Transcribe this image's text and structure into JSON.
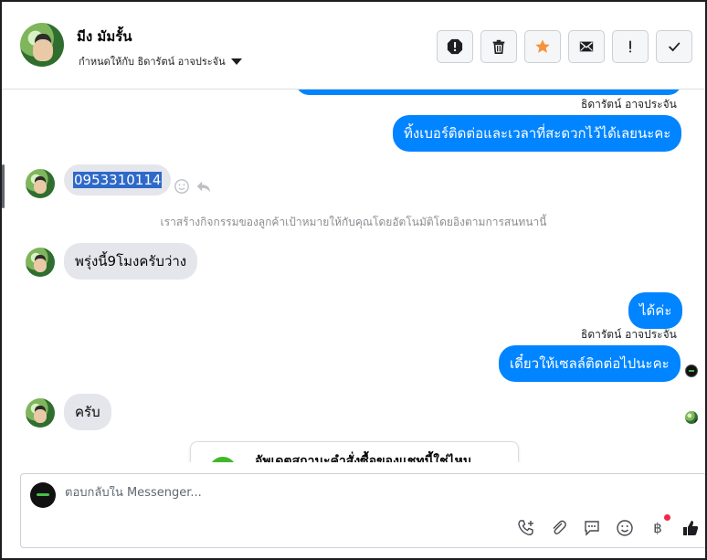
{
  "header": {
    "contact_name": "มีง มัมรั้น",
    "assigned_to": "กำหนดให้กับ ธิดารัตน์ อาจประจัน",
    "actions": [
      "spam-icon",
      "delete-icon",
      "star-icon",
      "unread-icon",
      "follow-up-icon",
      "done-icon"
    ]
  },
  "thread": {
    "sender_label_1": "ธิดารัตน์ อาจประจัน",
    "msg_out_1": "ทิ้งเบอร์ติดต่อและเวลาที่สะดวกไว้ได้เลยนะคะ",
    "msg_in_1": "0953310114",
    "notice": "เราสร้างกิจกรรมของลูกค้าเป้าหมายให้กับคุณโดยอัตโนมัติโดยอิงตามการสนทนานี้",
    "msg_in_2": "พรุ่งนี้9โมงครับว่าง",
    "msg_out_2": "ได้ค่ะ",
    "sender_label_2": "ธิดารัตน์ อาจประจัน",
    "msg_out_3": "เดี๋ยวให้เซลล์ติดต่อไปนะคะ",
    "msg_in_3": "ครับ",
    "card_title": "อัพเดตสถานะคำสั่งซื้อของแชทนี้ใช่ไหม"
  },
  "composer": {
    "placeholder": "ตอบกลับใน Messenger..."
  },
  "colors": {
    "outgoing_bubble": "#0084ff",
    "incoming_bubble": "#e4e6eb",
    "star": "#f7923a"
  }
}
